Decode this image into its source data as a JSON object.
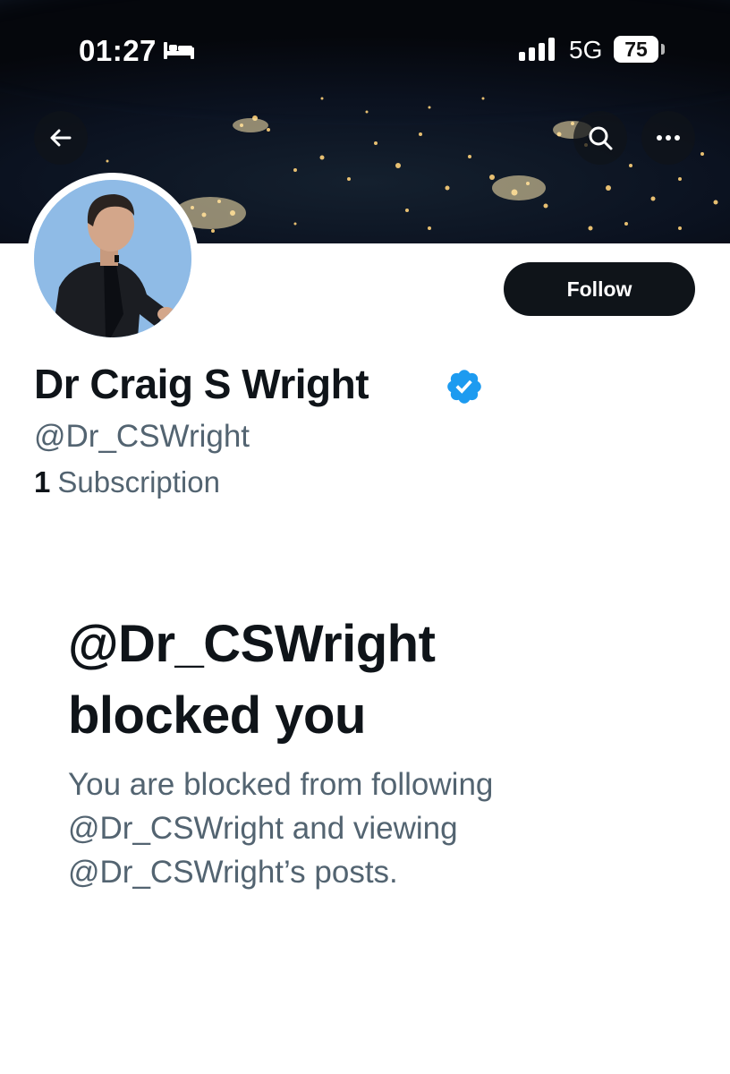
{
  "status_bar": {
    "time": "01:27",
    "network": "5G",
    "battery": "75",
    "icons": [
      "bed-icon",
      "signal-icon",
      "battery-icon"
    ]
  },
  "nav": {
    "icons": [
      "back-arrow-icon",
      "search-icon",
      "more-icon"
    ]
  },
  "profile": {
    "display_name": "Dr Craig S Wright",
    "handle": "@Dr_CSWright",
    "subscription_count": "1",
    "subscription_label": "Subscription",
    "follow_label": "Follow",
    "verified_color": "#1d9bf0"
  },
  "blocked": {
    "title_line1": "@Dr_CSWright",
    "title_line2": "blocked you",
    "desc_line1": "You are blocked from following",
    "desc_line2": "@Dr_CSWright and viewing",
    "desc_line3": "@Dr_CSWright’s posts."
  },
  "colors": {
    "text_primary": "#0f1419",
    "text_secondary": "#536471",
    "button_dark": "#0f1419",
    "verified_blue": "#1d9bf0"
  }
}
